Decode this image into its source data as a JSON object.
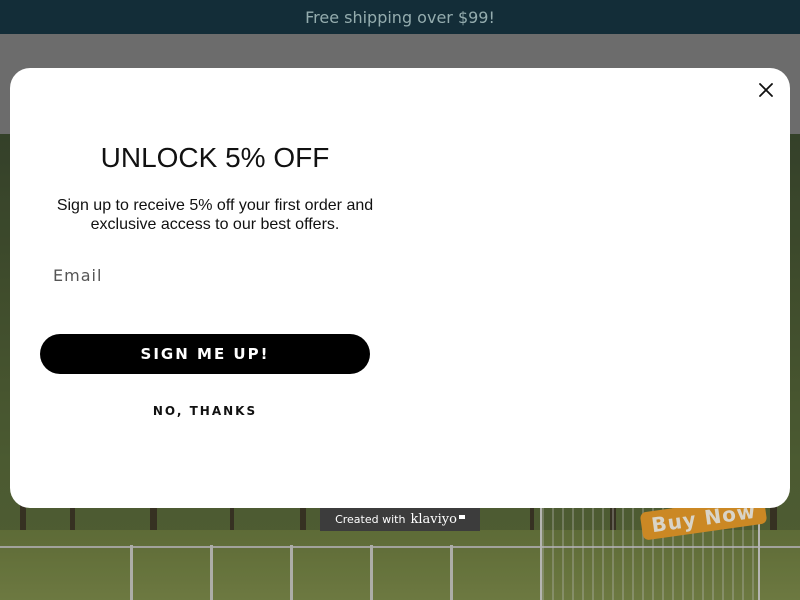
{
  "announcement": {
    "text": "Free shipping over $99!"
  },
  "hero": {
    "badge_text": "Buy Now"
  },
  "popup": {
    "title": "UNLOCK 5% OFF",
    "subtitle": "Sign up to receive 5% off your first order and exclusive access to our best offers.",
    "email_placeholder": "Email",
    "email_value": "",
    "submit_label": "SIGN ME UP!",
    "decline_label": "NO, THANKS",
    "close_icon": "close-icon"
  },
  "attribution": {
    "prefix": "Created with",
    "brand": "klaviyo"
  },
  "colors": {
    "announcement_bg": "#163440",
    "button_bg": "#000000",
    "badge": "#e89b2a"
  }
}
